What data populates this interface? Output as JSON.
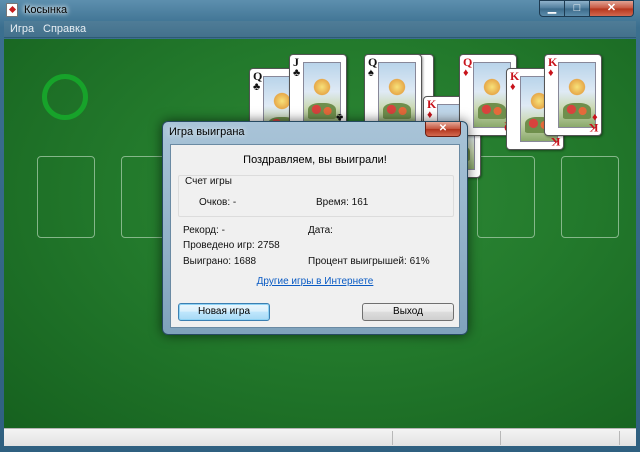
{
  "window": {
    "title": "Косынка",
    "minimize_glyph": "▁",
    "maximize_glyph": "□",
    "close_glyph": "✕"
  },
  "menu": {
    "items": [
      {
        "label": "Игра"
      },
      {
        "label": "Справка"
      }
    ]
  },
  "tableau": {
    "top_cards": [
      {
        "rank": "Q",
        "suit": "♣",
        "color": "black"
      },
      {
        "rank": "J",
        "suit": "♣",
        "color": "black"
      },
      {
        "rank": "Q",
        "suit": "♠",
        "color": "black"
      },
      {
        "rank": "K",
        "suit": "♦",
        "color": "red"
      },
      {
        "rank": "Q",
        "suit": "♦",
        "color": "red"
      },
      {
        "rank": "K",
        "suit": "♦",
        "color": "red"
      },
      {
        "rank": "K",
        "suit": "♦",
        "color": "red"
      }
    ]
  },
  "dialog": {
    "title": "Игра выиграна",
    "close_glyph": "✕",
    "congrats": "Поздравляем, вы выиграли!",
    "score_group_label": "Счет игры",
    "points_label": "Очков: -",
    "time_label": "Время:  161",
    "record_label": "Рекорд: -",
    "date_label": "Дата:",
    "games_played_label": "Проведено игр: 2758",
    "games_won_label": "Выиграно: 1688",
    "win_percent_label": "Процент выигрышей: 61%",
    "more_games_link": "Другие игры в Интернете",
    "new_game_button": "Новая игра",
    "exit_button": "Выход"
  },
  "colors": {
    "felt": "#237a2c",
    "card_red": "#c8131b",
    "link": "#0a5bc4",
    "stock_ring": "#17a32a"
  }
}
